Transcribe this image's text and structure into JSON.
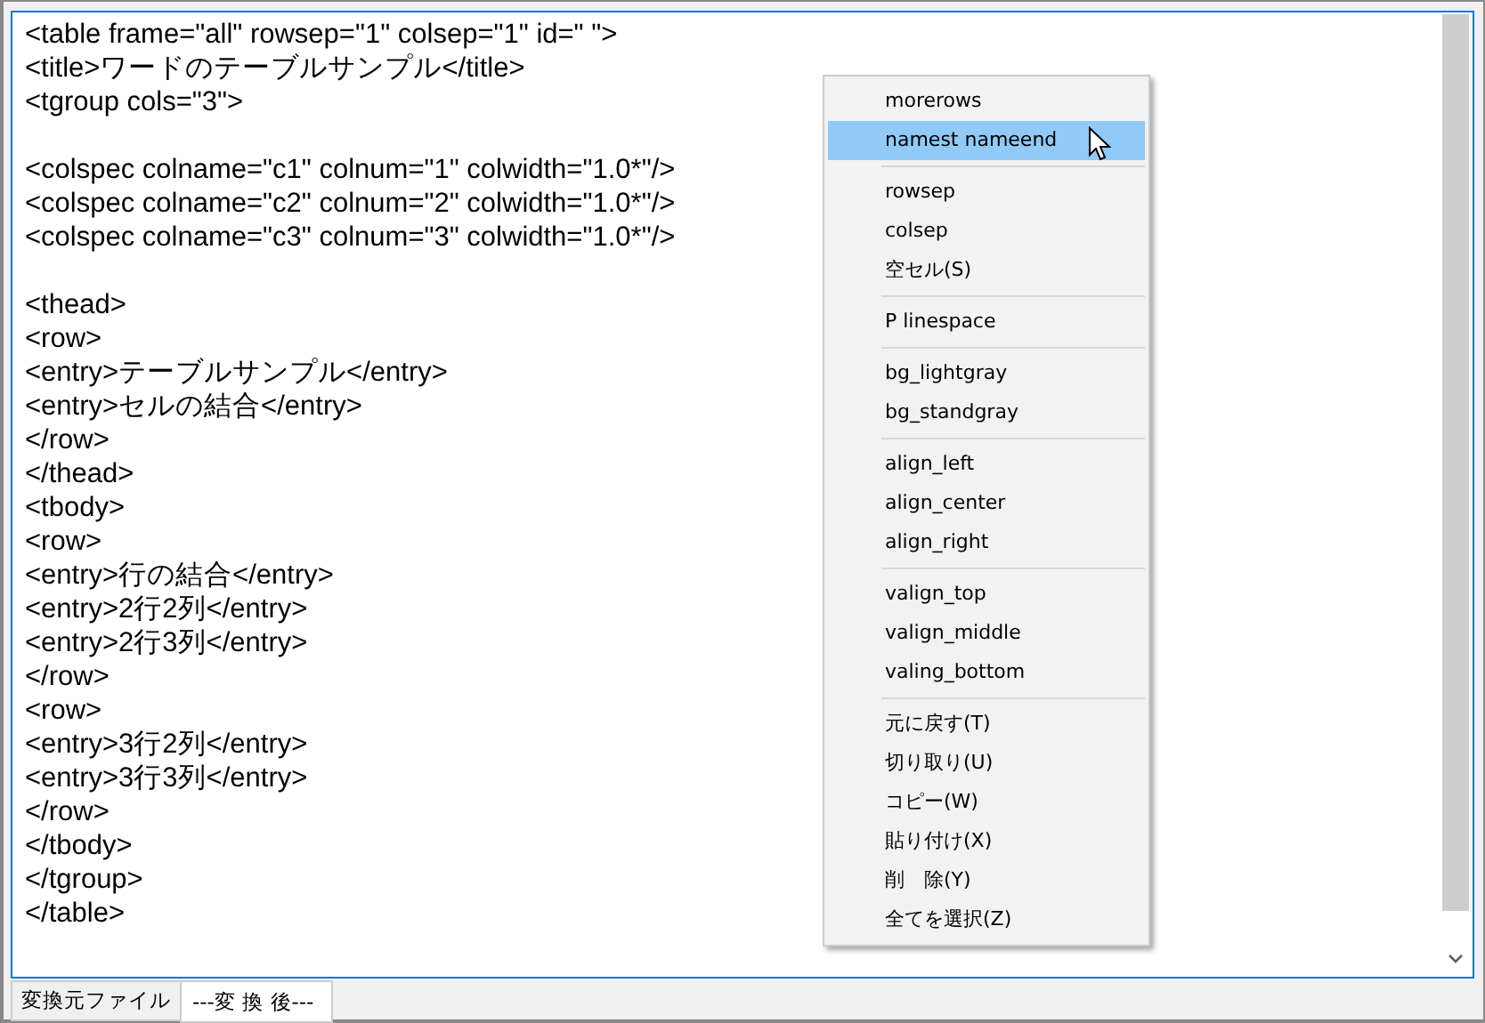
{
  "editor": {
    "content": "<table frame=\"all\" rowsep=\"1\" colsep=\"1\" id=\" \">\n<title>ワードのテーブルサンプル</title>\n<tgroup cols=\"3\">\n\n<colspec colname=\"c1\" colnum=\"1\" colwidth=\"1.0*\"/>\n<colspec colname=\"c2\" colnum=\"2\" colwidth=\"1.0*\"/>\n<colspec colname=\"c3\" colnum=\"3\" colwidth=\"1.0*\"/>\n\n<thead>\n<row>\n<entry>テーブルサンプル</entry>\n<entry>セルの結合</entry>\n</row>\n</thead>\n<tbody>\n<row>\n<entry>行の結合</entry>\n<entry>2行2列</entry>\n<entry>2行3列</entry>\n</row>\n<row>\n<entry>3行2列</entry>\n<entry>3行3列</entry>\n</row>\n</tbody>\n</tgroup>\n</table>"
  },
  "context_menu": {
    "groups": [
      [
        {
          "label": "morerows",
          "selected": false
        },
        {
          "label": "namest nameend",
          "selected": true
        }
      ],
      [
        {
          "label": "rowsep",
          "selected": false
        },
        {
          "label": "colsep",
          "selected": false
        },
        {
          "label": "空セル(S)",
          "selected": false
        }
      ],
      [
        {
          "label": "P linespace",
          "selected": false
        }
      ],
      [
        {
          "label": "bg_lightgray",
          "selected": false
        },
        {
          "label": "bg_standgray",
          "selected": false
        }
      ],
      [
        {
          "label": "align_left",
          "selected": false
        },
        {
          "label": "align_center",
          "selected": false
        },
        {
          "label": "align_right",
          "selected": false
        }
      ],
      [
        {
          "label": "valign_top",
          "selected": false
        },
        {
          "label": "valign_middle",
          "selected": false
        },
        {
          "label": "valing_bottom",
          "selected": false
        }
      ],
      [
        {
          "label": "元に戻す(T)",
          "selected": false
        },
        {
          "label": "切り取り(U)",
          "selected": false
        },
        {
          "label": "コピー(W)",
          "selected": false
        },
        {
          "label": "貼り付け(X)",
          "selected": false
        },
        {
          "label": "削　除(Y)",
          "selected": false
        },
        {
          "label": "全てを選択(Z)",
          "selected": false
        }
      ]
    ]
  },
  "tabs": [
    {
      "label": "変換元ファイル",
      "selected": false
    },
    {
      "label": "---変 換 後---",
      "selected": true
    }
  ]
}
